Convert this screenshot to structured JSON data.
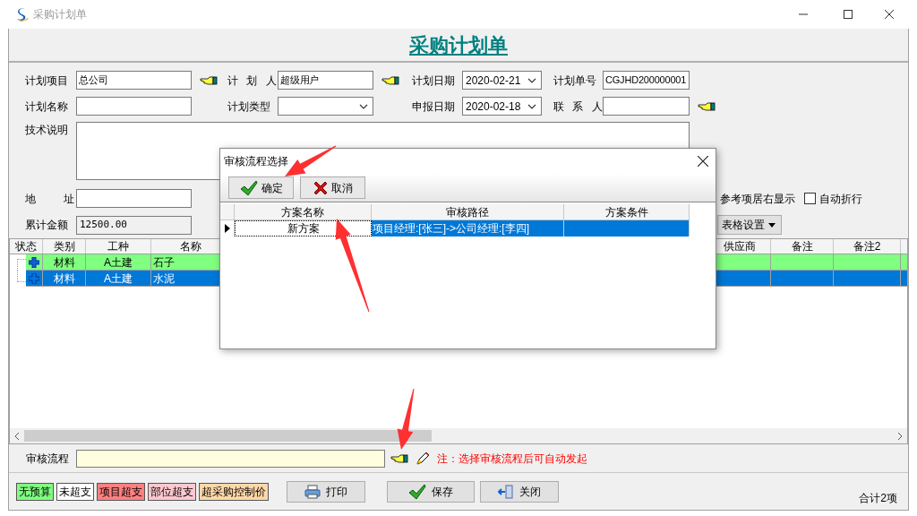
{
  "window": {
    "title": "采购计划单"
  },
  "header": {
    "title": "采购计划单"
  },
  "form": {
    "rows": [
      [
        {
          "label": "计划项目",
          "kind": "text",
          "value": "总公司",
          "lookup": true
        },
        {
          "label": "计 划 人",
          "kind": "text",
          "value": "超级用户",
          "lookup": true
        },
        {
          "label": "计划日期",
          "kind": "select",
          "value": "2020-02-21",
          "lookup": false
        },
        {
          "label": "计划单号",
          "kind": "text",
          "value": "CGJHD200000001",
          "lookup": false
        }
      ],
      [
        {
          "label": "计划名称",
          "kind": "text",
          "lookup": false
        },
        {
          "label": "计划类型",
          "kind": "select",
          "lookup": false
        },
        {
          "label": "申报日期",
          "kind": "select",
          "value": "2020-02-18",
          "lookup": false
        },
        {
          "label": "联 系 人",
          "kind": "text",
          "lookup": true
        }
      ],
      [
        {
          "label": "技术说明",
          "kind": "textarea",
          "lookup": false
        }
      ],
      [
        {
          "label": "地 址",
          "kind": "text",
          "lookup": false
        }
      ],
      [
        {
          "label": "累计金额",
          "kind": "readonly",
          "value": "12500.00",
          "lookup": false
        }
      ]
    ]
  },
  "options": {
    "note": "参考项居右显示",
    "checkbox": {
      "label": "自动折行",
      "checked": false
    },
    "table_settings": "表格设置"
  },
  "grid": {
    "columns": [
      "状态",
      "类别",
      "工种",
      "名称",
      "供应商",
      "备注",
      "备注2"
    ],
    "rows": [
      {
        "cells": [
          "",
          "材料",
          "A土建",
          "石子"
        ],
        "selected": false,
        "color": "#80ff80"
      },
      {
        "cells": [
          "",
          "材料",
          "A土建",
          "水泥"
        ],
        "selected": true
      }
    ]
  },
  "approval": {
    "label": "审核流程",
    "note": "注：选择审核流程后可自动发起"
  },
  "legend": [
    {
      "label": "无预算",
      "color": "#80ff80"
    },
    {
      "label": "未超支",
      "color": "#ffffff"
    },
    {
      "label": "项目超支",
      "color": "#ff8080"
    },
    {
      "label": "部位超支",
      "color": "#ffc8d0"
    },
    {
      "label": "超采购控制价",
      "color": "#ffd8a8"
    }
  ],
  "actions": [
    {
      "label": "打印",
      "kind": "print"
    },
    {
      "label": "保存",
      "kind": "save"
    },
    {
      "label": "关闭",
      "kind": "close"
    }
  ],
  "summary": "合计2项",
  "dialog": {
    "title": "审核流程选择",
    "buttons": [
      {
        "label": "确定",
        "kind": "ok"
      },
      {
        "label": "取消",
        "kind": "cancel"
      }
    ],
    "columns": [
      "方案名称",
      "审核路径",
      "方案条件"
    ],
    "rows": [
      {
        "cells": [
          "新方案",
          "项目经理:[张三]->公司经理:[李四]"
        ],
        "selected": true
      }
    ]
  }
}
